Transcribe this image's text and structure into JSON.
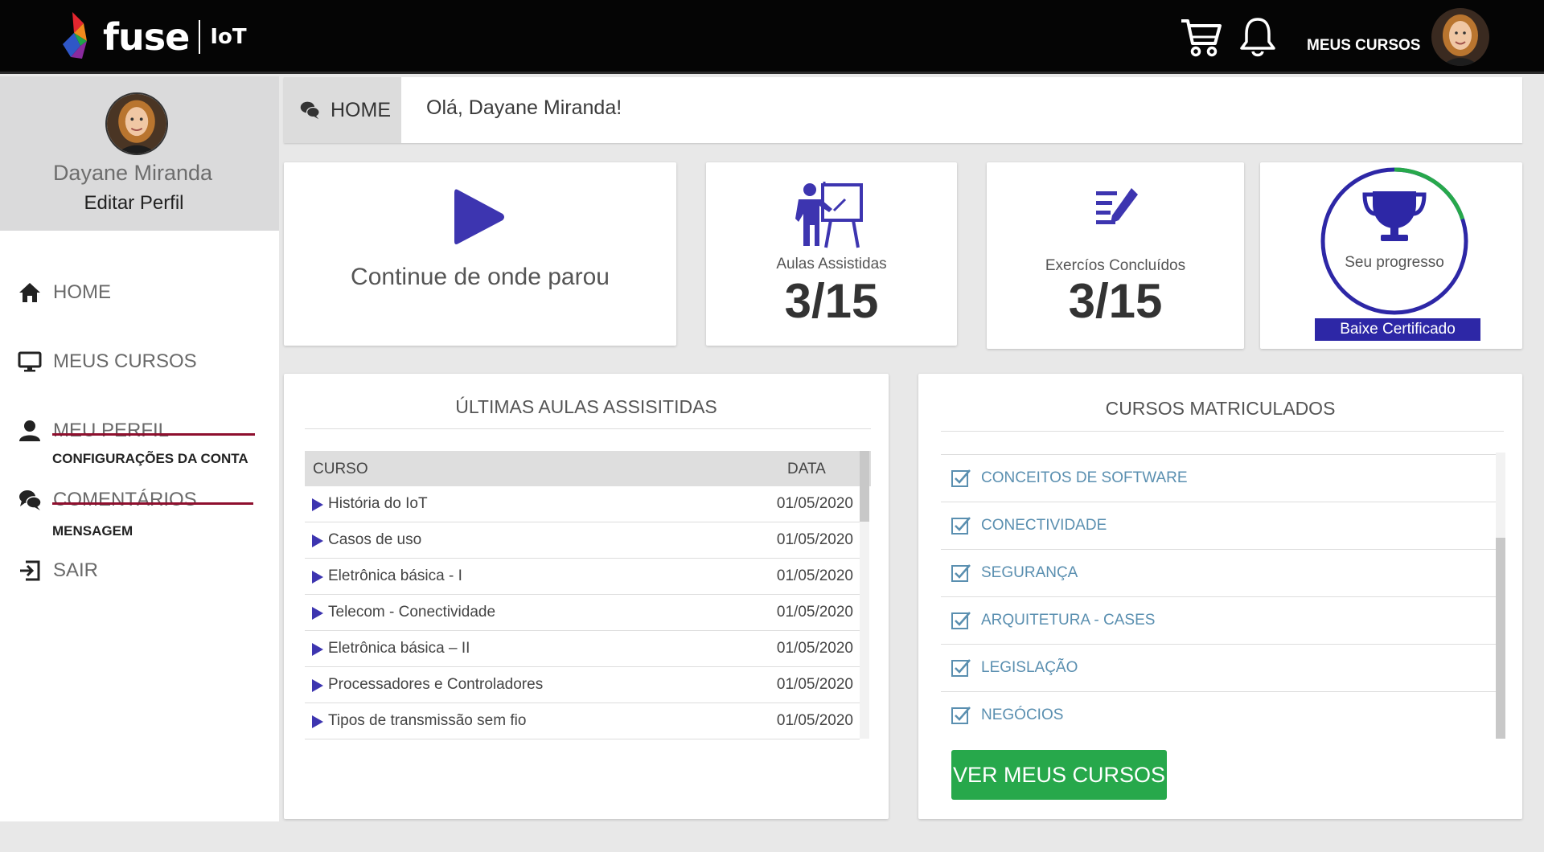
{
  "brand": {
    "name": "fuse",
    "suffix": "IoT"
  },
  "topbar": {
    "my_courses": "MEUS CURSOS"
  },
  "profile": {
    "name": "Dayane Miranda",
    "edit": "Editar Perfil"
  },
  "sidebar": {
    "items": [
      {
        "label": "HOME"
      },
      {
        "label": "MEUS CURSOS"
      },
      {
        "label": "MEU PERFIL",
        "sub": "CONFIGURAÇÕES DA CONTA"
      },
      {
        "label": "COMENTÁRIOS",
        "sub": "MENSAGEM"
      },
      {
        "label": "SAIR"
      }
    ]
  },
  "header": {
    "tab": "HOME",
    "greeting": "Olá, Dayane Miranda!"
  },
  "continue": {
    "label": "Continue de onde parou"
  },
  "stats": {
    "lessons": {
      "label": "Aulas Assistidas",
      "value": "3/15"
    },
    "exercises": {
      "label": "Exercíos Concluídos",
      "value": "3/15"
    },
    "progress": {
      "label": "Seu progresso",
      "fraction": 0.2,
      "button": "Baixe Certificado"
    }
  },
  "last_lessons": {
    "title": "ÚLTIMAS AULAS ASSISITIDAS",
    "columns": [
      "CURSO",
      "DATA"
    ],
    "rows": [
      {
        "course": "História do IoT",
        "date": "01/05/2020"
      },
      {
        "course": "Casos de uso",
        "date": "01/05/2020"
      },
      {
        "course": "Eletrônica básica - I",
        "date": "01/05/2020"
      },
      {
        "course": "Telecom - Conectividade",
        "date": "01/05/2020"
      },
      {
        "course": "Eletrônica básica – II",
        "date": "01/05/2020"
      },
      {
        "course": "Processadores e Controladores",
        "date": "01/05/2020"
      },
      {
        "course": "Tipos de transmissão sem fio",
        "date": "01/05/2020"
      }
    ]
  },
  "enrolled": {
    "title": "CURSOS MATRICULADOS",
    "items": [
      "CONCEITOS DE SOFTWARE",
      "CONECTIVIDADE",
      "SEGURANÇA",
      "ARQUITETURA - CASES",
      "LEGISLAÇÃO",
      "NEGÓCIOS"
    ],
    "button": "VER MEUS CURSOS"
  },
  "colors": {
    "accent": "#3d35b0",
    "green": "#27a84b",
    "strike": "#8e0f2e",
    "link": "#5a8fb0"
  }
}
